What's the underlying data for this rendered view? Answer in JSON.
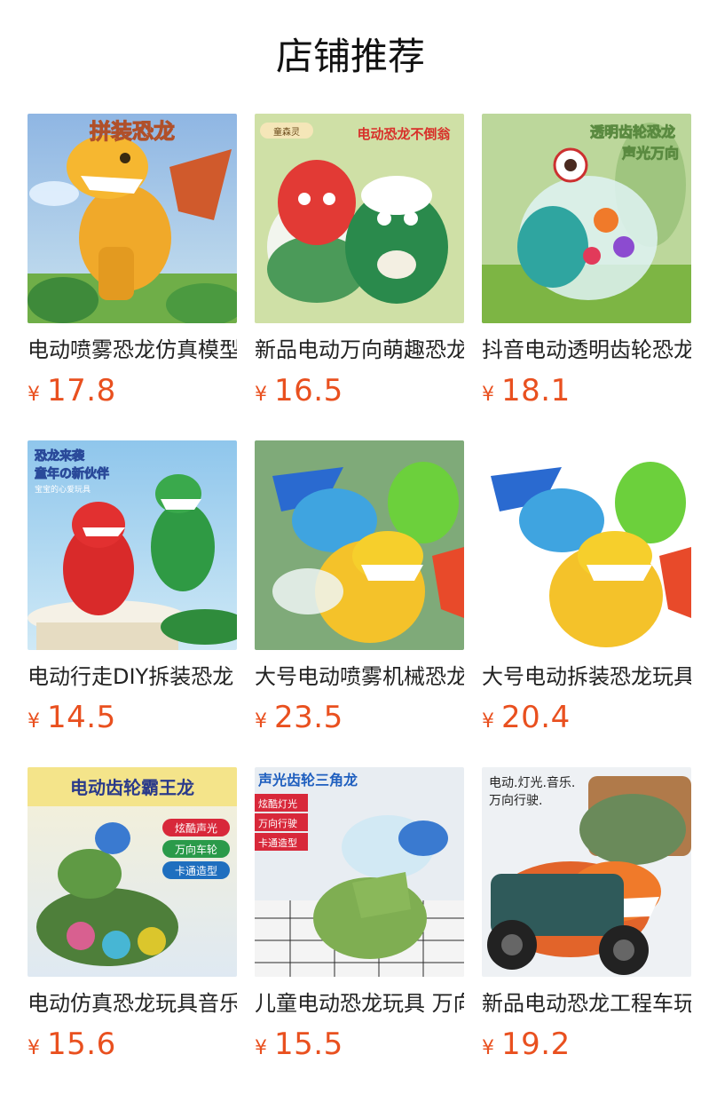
{
  "section": {
    "title": "店铺推荐"
  },
  "currency_symbol": "¥",
  "products": [
    {
      "title": "电动喷雾恐龙仿真模型",
      "price": "17.8",
      "banner": "拼装恐龙",
      "badge": "",
      "lines": []
    },
    {
      "title": "新品电动万向萌趣恐龙",
      "price": "16.5",
      "banner": "电动恐龙不倒翁",
      "badge": "童森灵",
      "lines": []
    },
    {
      "title": "抖音电动透明齿轮恐龙",
      "price": "18.1",
      "banner": "透明齿轮恐龙",
      "badge": "声光万向",
      "lines": []
    },
    {
      "title": "电动行走DIY拆装恐龙",
      "price": "14.5",
      "banner": "恐龙来袭",
      "badge": "童年の新伙伴",
      "lines": [
        "宝宝的心爱玩具"
      ]
    },
    {
      "title": "大号电动喷雾机械恐龙",
      "price": "23.5",
      "banner": "",
      "badge": "",
      "lines": []
    },
    {
      "title": "大号电动拆装恐龙玩具",
      "price": "20.4",
      "banner": "",
      "badge": "",
      "lines": []
    },
    {
      "title": "电动仿真恐龙玩具音乐",
      "price": "15.6",
      "banner": "电动齿轮霸王龙",
      "badge": "",
      "lines": [
        "炫酷声光",
        "万向车轮",
        "卡通造型"
      ]
    },
    {
      "title": "儿童电动恐龙玩具 万向",
      "price": "15.5",
      "banner": "声光齿轮三角龙",
      "badge": "",
      "lines": [
        "炫酷灯光",
        "万向行驶",
        "卡通造型"
      ]
    },
    {
      "title": "新品电动恐龙工程车玩具",
      "price": "19.2",
      "banner": "电动.灯光.音乐.",
      "badge": "万向行驶.",
      "lines": []
    }
  ],
  "colors": {
    "price": "#e9501f",
    "title": "#222222",
    "heading": "#111111"
  }
}
